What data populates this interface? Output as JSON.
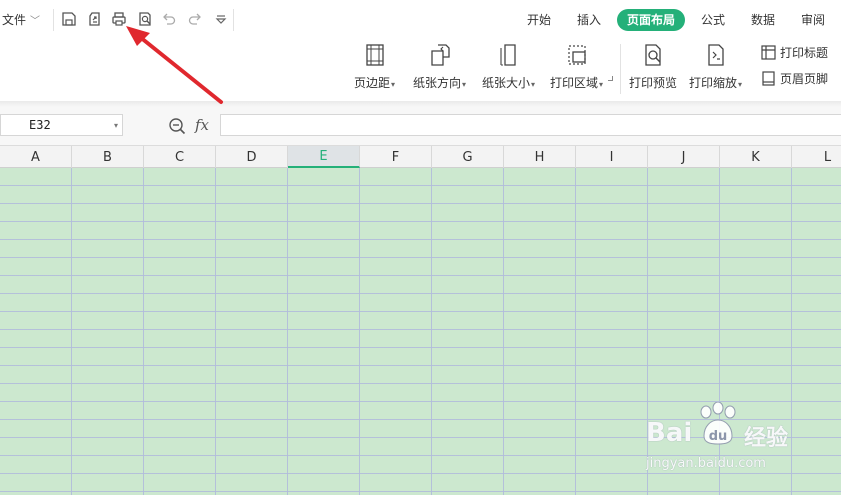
{
  "quick_access": {
    "file_label": "文件",
    "icons": [
      "save-icon",
      "export-pdf-icon",
      "print-icon",
      "print-preview-icon",
      "undo-icon",
      "redo-icon",
      "customize-dropdown-icon"
    ]
  },
  "tabs": [
    {
      "label": "开始",
      "active": false
    },
    {
      "label": "插入",
      "active": false
    },
    {
      "label": "页面布局",
      "active": true
    },
    {
      "label": "公式",
      "active": false
    },
    {
      "label": "数据",
      "active": false
    },
    {
      "label": "审阅",
      "active": false
    }
  ],
  "ribbon": {
    "margins": "页边距",
    "orientation": "纸张方向",
    "size": "纸张大小",
    "print_area": "打印区域",
    "print_preview": "打印预览",
    "print_scale": "打印缩放",
    "print_titles": "打印标题",
    "header_footer": "页眉页脚"
  },
  "formula_bar": {
    "name_box": "E32",
    "fx_label": "fx",
    "formula": ""
  },
  "columns": [
    "A",
    "B",
    "C",
    "D",
    "E",
    "F",
    "G",
    "H",
    "I",
    "J",
    "K",
    "L"
  ],
  "selected_column": "E",
  "colors": {
    "accent": "#24b079",
    "cell_background": "#cce8cf",
    "gridline": "#b2bcdc",
    "annotation_arrow": "#e0282e"
  },
  "watermark": {
    "brand": "Bai",
    "brand_cn": "经验",
    "url": "jingyan.baidu.com"
  }
}
